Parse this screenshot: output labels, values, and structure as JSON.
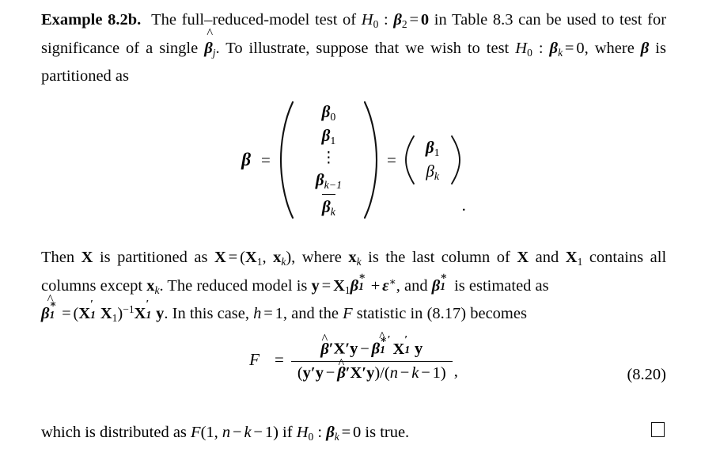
{
  "document": {
    "example_label": "Example 8.2b.",
    "paragraph1": {
      "text_before_h0": "The full",
      "dash": "–",
      "text_reduced": "reduced-model test of",
      "h0_base": "H",
      "h0_sub": "0",
      "colon": ":",
      "beta_symbol": "β",
      "beta2_sub": "2",
      "equals": "=",
      "zero_bold": "0",
      "text_table": "in Table 8.3 can be used to test for significance of a single",
      "beta_hat": "β",
      "beta_hat_sub": "j",
      "hat_accent": "^",
      "text_illustrate": ". To illustrate, suppose that we wish to test",
      "h0b_base": "H",
      "h0b_sub": "0",
      "betak_sub": "k",
      "zero_plain": "0",
      "text_where": ", where",
      "text_partitioned": "is partitioned as"
    },
    "beta_matrix": {
      "lhs": "β",
      "eq1": "=",
      "entries": [
        "β₀",
        "β₁",
        "⋮",
        "β_{k-1}",
        "β_k"
      ],
      "entry_labels": [
        {
          "base": "β",
          "sub": "0",
          "bold": false
        },
        {
          "base": "β",
          "sub": "1",
          "bold": false
        },
        {
          "base": "⋮",
          "sub": "",
          "bold": false
        },
        {
          "base": "β",
          "sub": "k−1",
          "bold": false
        },
        {
          "base": "β",
          "sub": "k",
          "bold": false
        }
      ],
      "eq2": "=",
      "rhs_entries": [
        {
          "base": "β",
          "sub": "1",
          "bold": true
        },
        {
          "base": "β",
          "sub": "k",
          "bold": false
        }
      ],
      "period": "."
    },
    "paragraph2": {
      "line1": "Then X is partitioned as X = (X₁, xₖ), where xₖ is the last column of X and X₁ contains",
      "line2": "all columns except xₖ. The reduced model is y = X₁β₁* + ε*, and β₁* is estimated as",
      "line3": "β̂₁* = (X₁′X₁)⁻¹X₁′y. In this case, h = 1, and the F statistic in (8.17) becomes",
      "tokens": {
        "then": "Then",
        "X": "X",
        "is_partitioned_as": "is partitioned as",
        "eq": "=",
        "open": "(",
        "X1_sub": "1",
        "comma": ",",
        "x_lower": "x",
        "k_sub": "k",
        "close": ")",
        "where": ", where",
        "is_last_col": "is the last column of",
        "and": "and",
        "contains": "contains",
        "all_cols_except": "all columns except",
        "period": ".",
        "reduced_model_is": "The reduced model is",
        "y": "y",
        "beta": "β",
        "star": "∗",
        "plus": "+",
        "epsilon": "ε",
        "and2": ", and",
        "is_estimated_as": "is estimated as",
        "inverse": "−1",
        "prime": "′",
        "in_this_case": ". In this case,",
        "h": "h",
        "one": "1",
        "and_the": ", and the",
        "F": "F",
        "statistic_in": "statistic in",
        "ref": "(8.17)",
        "becomes": "becomes"
      }
    },
    "f_equation": {
      "lhs": "F",
      "equals": "=",
      "numerator": "β̂′X′y − β̂₁*′X₁′y",
      "denominator": "(y′y − β̂′X′y)/(n − k − 1)",
      "trailing_comma": ",",
      "equation_number": "(8.20)",
      "num_tokens": {
        "beta": "β",
        "hat": "^",
        "prime": "′",
        "X": "X",
        "y": "y",
        "minus": "−",
        "star": "∗",
        "sub1": "1"
      },
      "den_tokens": {
        "open": "(",
        "y": "y",
        "prime": "′",
        "minus": "−",
        "beta": "β",
        "X": "X",
        "close": ")",
        "slash": "/",
        "n": "n",
        "k": "k",
        "one": "1"
      }
    },
    "last_line": {
      "text_start": "which is distributed as",
      "F": "F",
      "open": "(",
      "one": "1",
      "comma": ",",
      "n": "n",
      "minus": "−",
      "k": "k",
      "close": ")",
      "if": "if",
      "h0_base": "H",
      "h0_sub": "0",
      "colon": ":",
      "beta": "β",
      "beta_sub": "k",
      "equals": "=",
      "zero": "0",
      "text_end": "is true.",
      "qed_symbol": "□"
    }
  }
}
